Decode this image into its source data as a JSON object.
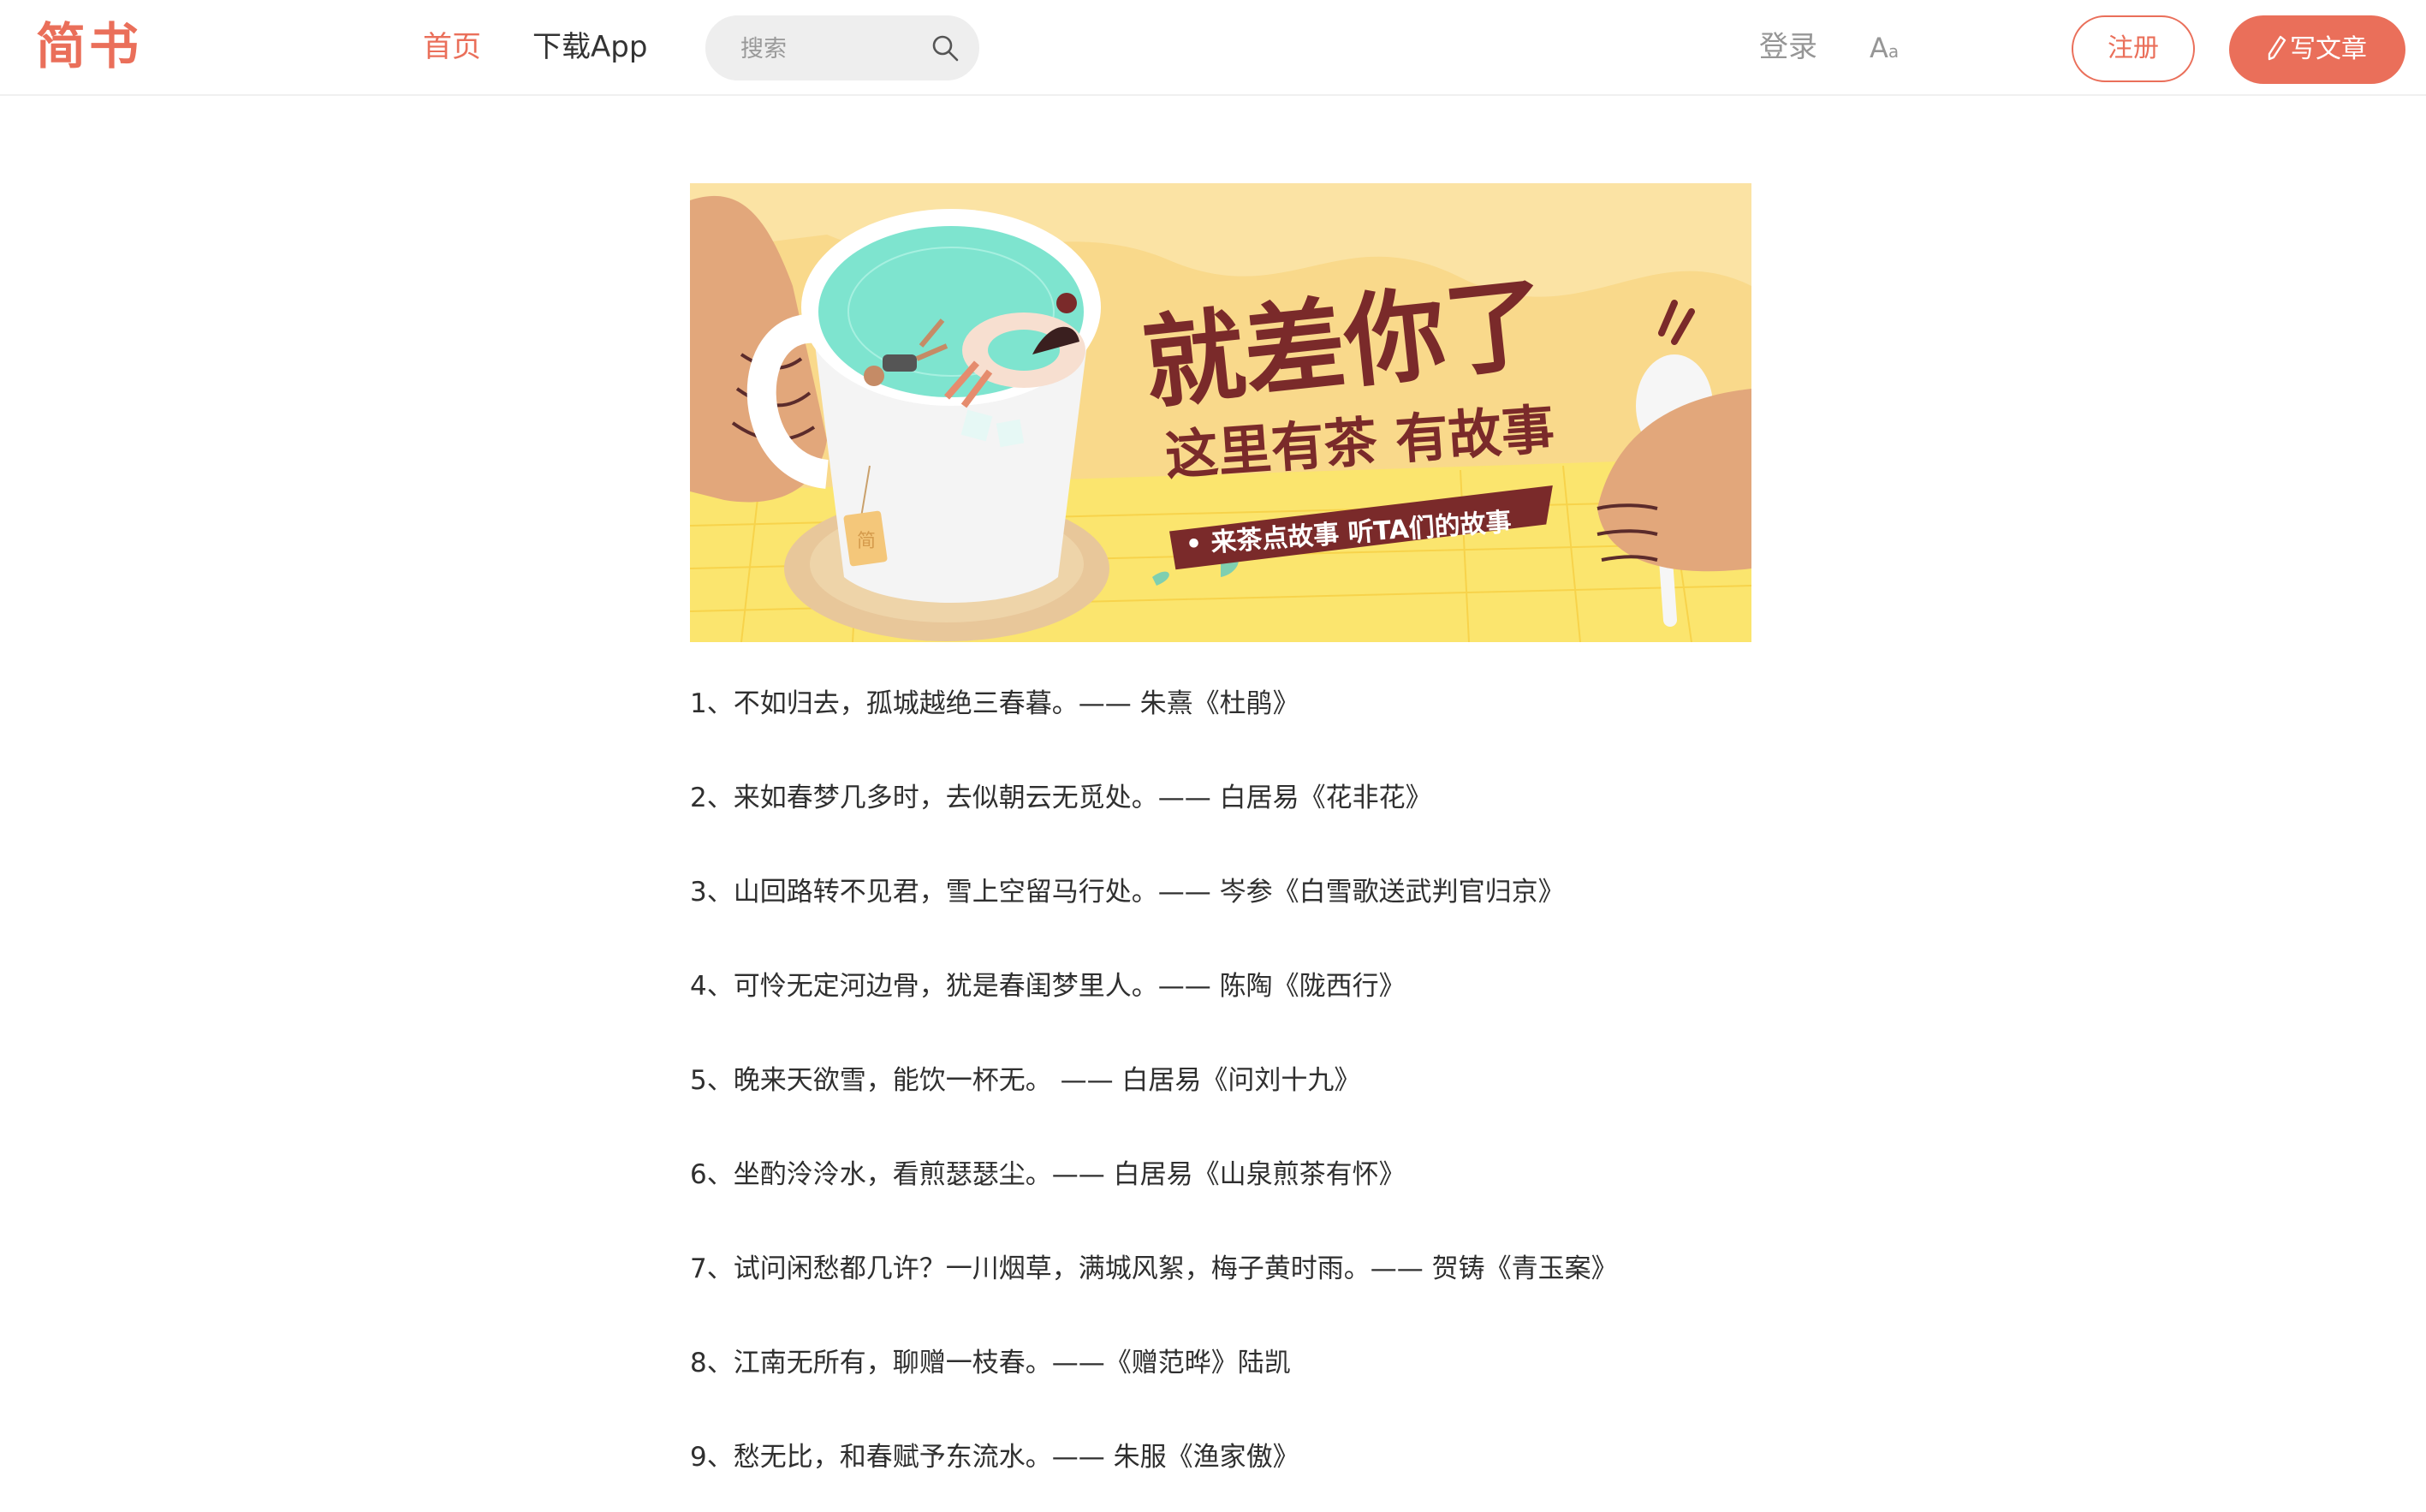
{
  "header": {
    "logo": "简书",
    "nav_home": "首页",
    "nav_app": "下载App",
    "search_placeholder": "搜索",
    "login": "登录",
    "font_toggle_big": "A",
    "font_toggle_small": "a",
    "register": "注册",
    "write": "写文章"
  },
  "banner": {
    "headline": "就差你了",
    "subheadline": "这里有茶 有故事",
    "ribbon": "• 来茶点故事 听TA们的故事",
    "tag_glyph": "简"
  },
  "poems": [
    "1、不如归去，孤城越绝三春暮。—— 朱熹《杜鹃》",
    "2、来如春梦几多时，去似朝云无觅处。—— 白居易《花非花》",
    "3、山回路转不见君，雪上空留马行处。—— 岑参《白雪歌送武判官归京》",
    "4、可怜无定河边骨，犹是春闺梦里人。—— 陈陶《陇西行》",
    "5、晚来天欲雪，能饮一杯无。 —— 白居易《问刘十九》",
    "6、坐酌泠泠水，看煎瑟瑟尘。—— 白居易《山泉煎茶有怀》",
    "7、试问闲愁都几许？一川烟草，满城风絮，梅子黄时雨。—— 贺铸《青玉案》",
    "8、江南无所有，聊赠一枝春。——《赠范晔》陆凯",
    "9、愁无比，和春赋予东流水。—— 朱服《渔家傲》"
  ],
  "colors": {
    "accent": "#ea6f5a",
    "muted": "#969696",
    "text": "#2f2f2f",
    "banner_bg": "#f9d98b",
    "banner_title": "#7a2a2a",
    "tea": "#7ee4cf"
  }
}
